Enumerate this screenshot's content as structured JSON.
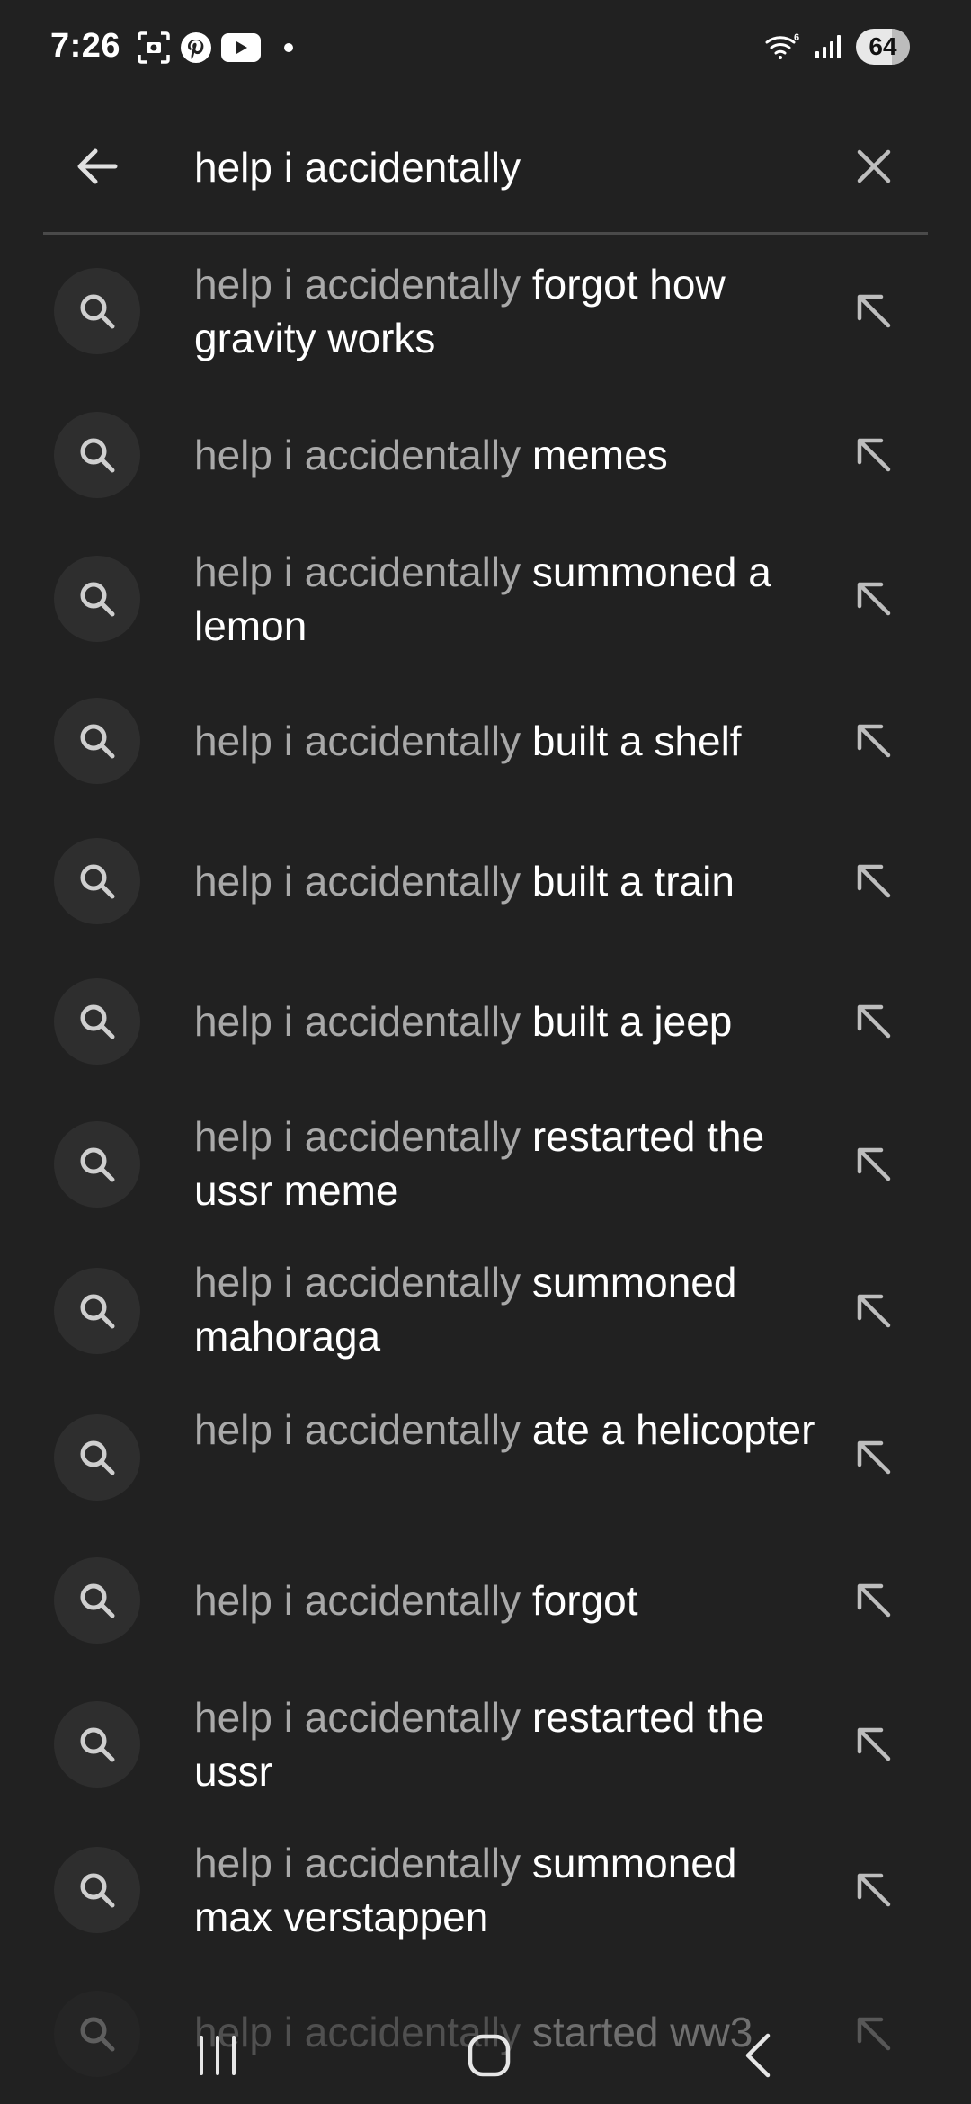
{
  "status_bar": {
    "time": "7:26",
    "battery": "64",
    "left_icons": [
      "screenshot-icon",
      "pinterest-icon",
      "youtube-icon",
      "notification-dot"
    ],
    "right_icons": [
      "wifi-6-icon",
      "signal-icon",
      "battery-icon"
    ]
  },
  "search": {
    "query": "help i accidentally",
    "back_icon": "arrow-left-icon",
    "clear_icon": "close-icon"
  },
  "suggestions": [
    {
      "prefix": "help i accidentally",
      "suffix": " forgot how gravity works"
    },
    {
      "prefix": "help i accidentally",
      "suffix": " memes"
    },
    {
      "prefix": "help i accidentally",
      "suffix": " summoned a lemon"
    },
    {
      "prefix": "help i accidentally",
      "suffix": " built a shelf"
    },
    {
      "prefix": "help i accidentally",
      "suffix": " built a train"
    },
    {
      "prefix": "help i accidentally",
      "suffix": " built a jeep"
    },
    {
      "prefix": "help i accidentally",
      "suffix": " restarted the ussr meme"
    },
    {
      "prefix": "help i accidentally",
      "suffix": " summoned mahoraga"
    },
    {
      "prefix": "help i accidentally",
      "suffix": " ate a helicopter"
    },
    {
      "prefix": "help i accidentally",
      "suffix": " forgot"
    },
    {
      "prefix": "help i accidentally",
      "suffix": " restarted the ussr"
    },
    {
      "prefix": "help i accidentally",
      "suffix": " summoned max verstappen"
    },
    {
      "prefix": "help i accidentally",
      "suffix": " started ww3"
    }
  ],
  "colors": {
    "background": "#212121",
    "query_text": "#a9a9a9",
    "suggestion_text": "#ffffff",
    "icon_circle": "#2e2e2e",
    "divider": "#4a4a4a"
  },
  "nav_bar": {
    "icons": [
      "recent-apps-icon",
      "home-icon",
      "back-icon"
    ]
  }
}
